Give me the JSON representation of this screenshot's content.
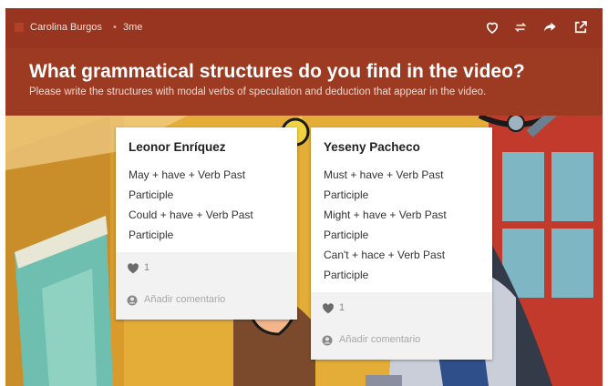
{
  "header": {
    "author": "Carolina Burgos",
    "separator": "•",
    "time": "3me",
    "title": "What grammatical structures do you find in the video?",
    "subtitle": "Please write the structures with modal verbs of speculation and deduction that appear in the video.",
    "icons": [
      "heart-icon",
      "remake-icon",
      "share-icon",
      "open-external-icon"
    ]
  },
  "posts": [
    {
      "author": "Leonor Enríquez",
      "lines": [
        "May + have + Verb Past",
        "Participle",
        "Could + have + Verb Past",
        "Participle"
      ],
      "likes": "1",
      "comment_placeholder": "Añadir comentario"
    },
    {
      "author": "Yeseny Pacheco",
      "lines": [
        "Must + have + Verb Past",
        "Participle",
        "Might + have + Verb Past",
        "Participle",
        "Can't + hace + Verb Past",
        "Participle"
      ],
      "likes": "1",
      "comment_placeholder": "Añadir comentario"
    }
  ],
  "colors": {
    "header_bg": "#9c3a22",
    "topbar_bg": "#973520",
    "card_bg": "#ffffff",
    "footer_bg": "#f2f2f2"
  }
}
